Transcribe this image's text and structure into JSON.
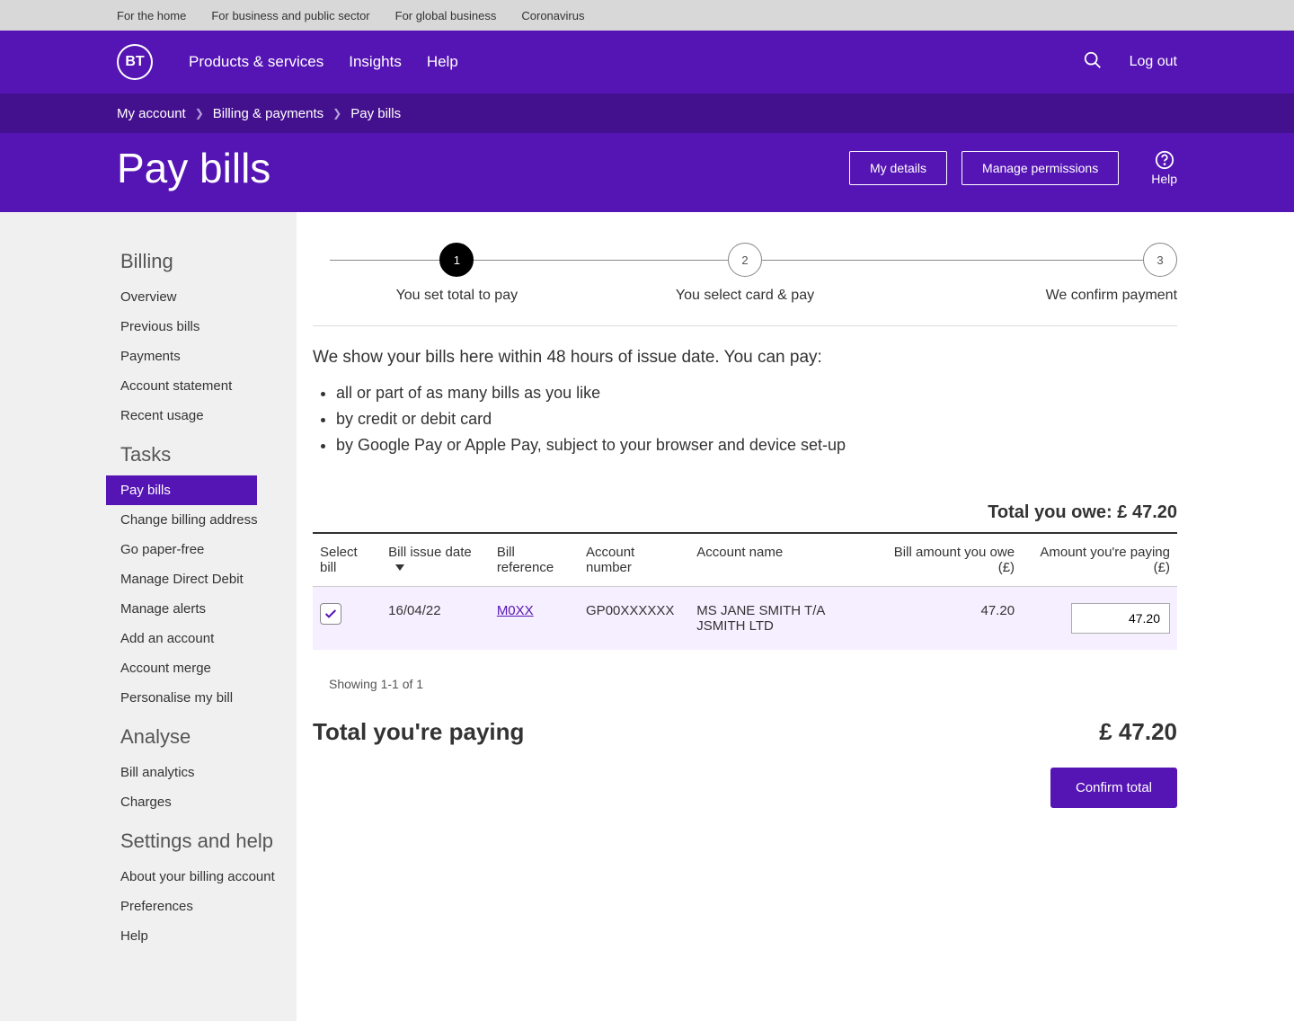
{
  "topbar": {
    "links": [
      "For the home",
      "For business and public sector",
      "For global business",
      "Coronavirus"
    ]
  },
  "header": {
    "logo": "BT",
    "nav": [
      "Products & services",
      "Insights",
      "Help"
    ],
    "logout": "Log out"
  },
  "breadcrumb": {
    "items": [
      "My account",
      "Billing & payments",
      "Pay bills"
    ]
  },
  "titlebar": {
    "title": "Pay bills",
    "my_details": "My details",
    "manage_permissions": "Manage permissions",
    "help": "Help"
  },
  "sidebar": {
    "sections": [
      {
        "heading": "Billing",
        "items": [
          "Overview",
          "Previous bills",
          "Payments",
          "Account statement",
          "Recent usage"
        ]
      },
      {
        "heading": "Tasks",
        "items": [
          "Pay bills",
          "Change billing address",
          "Go paper-free",
          "Manage Direct Debit",
          "Manage alerts",
          "Add an account",
          "Account merge",
          "Personalise my bill"
        ]
      },
      {
        "heading": "Analyse",
        "items": [
          "Bill analytics",
          "Charges"
        ]
      },
      {
        "heading": "Settings and help",
        "items": [
          "About your billing account",
          "Preferences",
          "Help"
        ]
      }
    ],
    "active": "Pay bills"
  },
  "stepper": {
    "steps": [
      {
        "num": "1",
        "label": "You set total to pay"
      },
      {
        "num": "2",
        "label": "You select card & pay"
      },
      {
        "num": "3",
        "label": "We confirm payment"
      }
    ],
    "active": 0
  },
  "intro": {
    "text": "We show your bills here within 48 hours of issue date. You can pay:",
    "bullets": [
      "all or part of as many bills as you like",
      "by credit or debit card",
      "by Google Pay or Apple Pay, subject to your browser and device set-up"
    ]
  },
  "totals": {
    "owe_label": "Total you owe:",
    "owe_value": "£ 47.20",
    "paying_label": "Total you're paying",
    "paying_value": "£ 47.20"
  },
  "table": {
    "headers": {
      "select": "Select bill",
      "issue": "Bill issue date",
      "ref": "Bill reference",
      "account_num": "Account number",
      "account_name": "Account name",
      "owe": "Bill amount you owe (£)",
      "paying": "Amount you're paying (£)"
    },
    "rows": [
      {
        "checked": true,
        "issue": "16/04/22",
        "ref": "M0XX",
        "account_num": "GP00XXXXXX",
        "account_name": "MS JANE SMITH T/A JSMITH LTD",
        "owe": "47.20",
        "paying": "47.20"
      }
    ],
    "showing": "Showing 1-1 of 1"
  },
  "buttons": {
    "confirm": "Confirm total"
  }
}
